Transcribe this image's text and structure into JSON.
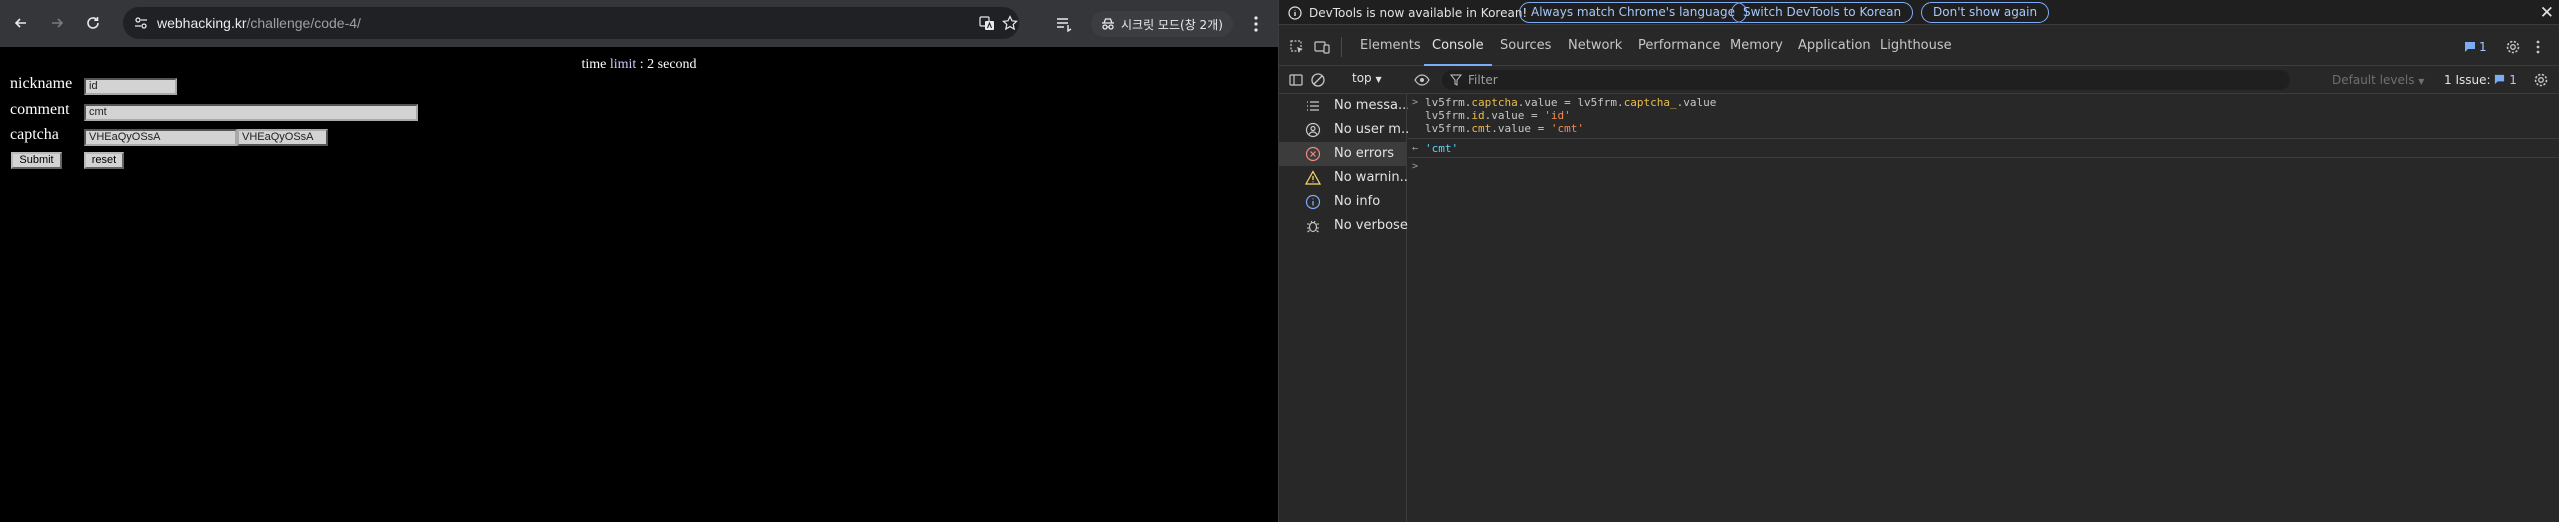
{
  "browser": {
    "url_host": "webhacking.kr",
    "url_path": "/challenge/code-4/",
    "incognito_label": "시크릿 모드(창 2개)",
    "page": {
      "time_limit_pre": "time ",
      "time_limit_word": "limit",
      "time_limit_post": " : 2 second",
      "nickname_label": "nickname",
      "nickname_value": "id",
      "comment_label": "comment",
      "comment_value": "cmt",
      "captcha_label": "captcha",
      "captcha_input_value": "VHEaQyOSsA",
      "captcha_shown_value": "VHEaQyOSsA",
      "submit_label": "Submit",
      "reset_label": "reset"
    }
  },
  "devtools": {
    "infobar_text": "DevTools is now available in Korean!",
    "btn_match": "Always match Chrome's language",
    "btn_switch": "Switch DevTools to Korean",
    "btn_dont_show": "Don't show again",
    "tabs": [
      "Elements",
      "Console",
      "Sources",
      "Network",
      "Performance",
      "Memory",
      "Application",
      "Lighthouse"
    ],
    "active_tab": "Console",
    "issues_badge_count": "1",
    "context": "top",
    "filter_placeholder": "Filter",
    "levels": "Default levels",
    "issues_text": "1 Issue:",
    "issues_count": "1",
    "sidebar": [
      {
        "label": "No messa...",
        "icon": "list-icon"
      },
      {
        "label": "No user m...",
        "icon": "user-icon"
      },
      {
        "label": "No errors",
        "icon": "error-icon"
      },
      {
        "label": "No warnin...",
        "icon": "warning-icon"
      },
      {
        "label": "No info",
        "icon": "info-icon"
      },
      {
        "label": "No verbose",
        "icon": "bug-icon"
      }
    ],
    "console": {
      "line1": {
        "obj1": "lv5frm.",
        "prop1": "captcha",
        "mid": ".value = lv5frm.",
        "prop2": "captcha_",
        "end": ".value"
      },
      "line2": {
        "obj": "lv5frm.",
        "prop": "id",
        "mid": ".value = ",
        "str": "'id'"
      },
      "line3": {
        "obj": "lv5frm.",
        "prop": "cmt",
        "mid": ".value = ",
        "str": "'cmt'"
      },
      "result": "'cmt'"
    },
    "colors": {
      "accent": "#7cacf8",
      "property": "#e9bd4c",
      "string": "#f28b54",
      "result": "#5cd5fb"
    }
  }
}
